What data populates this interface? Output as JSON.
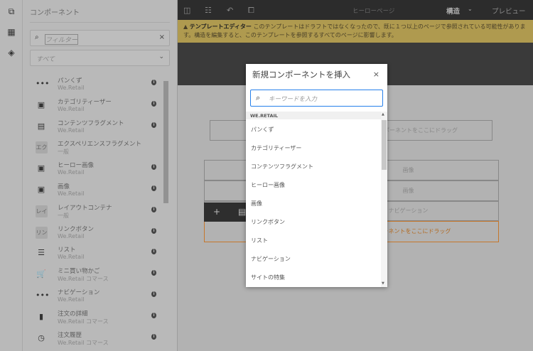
{
  "rail": {
    "icons": [
      "components-icon",
      "assets-icon",
      "layers-icon"
    ]
  },
  "panel": {
    "title": "コンポーネント",
    "filter_placeholder": "フィルター",
    "group_select": "すべて",
    "items": [
      {
        "icon": "breadcrumb-icon",
        "glyph": "•••",
        "title": "パンくず",
        "sub": "We.Retail",
        "info": true
      },
      {
        "icon": "image-icon",
        "glyph": "▣",
        "title": "カテゴリティーザー",
        "sub": "We.Retail",
        "info": true
      },
      {
        "icon": "content-fragment-icon",
        "glyph": "▤",
        "title": "コンテンツフラグメント",
        "sub": "We.Retail",
        "info": true
      },
      {
        "icon": "abbrev-icon",
        "abbr": "エク",
        "title": "エクスペリエンスフラグメント",
        "sub": "一般",
        "info": false
      },
      {
        "icon": "image-icon",
        "glyph": "▣",
        "title": "ヒーロー画像",
        "sub": "We.Retail",
        "info": true
      },
      {
        "icon": "image-icon",
        "glyph": "▣",
        "title": "画像",
        "sub": "We.Retail",
        "info": true
      },
      {
        "icon": "abbrev-icon",
        "abbr": "レイ",
        "title": "レイアウトコンテナ",
        "sub": "一般",
        "info": true
      },
      {
        "icon": "abbrev-icon",
        "abbr": "リン",
        "title": "リンクボタン",
        "sub": "We.Retail",
        "info": true
      },
      {
        "icon": "list-icon",
        "glyph": "☰",
        "title": "リスト",
        "sub": "We.Retail",
        "info": true
      },
      {
        "icon": "cart-icon",
        "glyph": "🛒",
        "title": "ミニ買い物かご",
        "sub": "We.Retail コマース",
        "info": true
      },
      {
        "icon": "navigation-icon",
        "glyph": "•••",
        "title": "ナビゲーション",
        "sub": "We.Retail",
        "info": true
      },
      {
        "icon": "clipboard-icon",
        "glyph": "▮",
        "title": "注文の詳細",
        "sub": "We.Retail コマース",
        "info": true
      },
      {
        "icon": "history-icon",
        "glyph": "◷",
        "title": "注文履歴",
        "sub": "We.Retail コマース",
        "info": true
      }
    ]
  },
  "toolbar": {
    "page_title": "ヒーローページ",
    "mode": "構造",
    "preview": "プレビュー"
  },
  "warning": {
    "label": "テンプレートエディター",
    "text": "このテンプレートはドラフトではなくなったので、既に１つ以上のページで参照されている可能性があります。構造を編集すると、このテンプレートを参照するすべてのページに影響します。"
  },
  "canvas": {
    "drop1": "コンポーネントをここにドラッグ",
    "image1": "画像",
    "image2": "画像",
    "nav": "ナビゲーション",
    "drop2": "コンポーネントをここにドラッグ"
  },
  "modal": {
    "title": "新規コンポーネントを挿入",
    "search_placeholder": "キーワードを入力",
    "group": "WE.RETAIL",
    "items": [
      "パンくず",
      "カテゴリティーザー",
      "コンテンツフラグメント",
      "ヒーロー画像",
      "画像",
      "リンクボタン",
      "リスト",
      "ナビゲーション",
      "サイトの特集"
    ]
  }
}
